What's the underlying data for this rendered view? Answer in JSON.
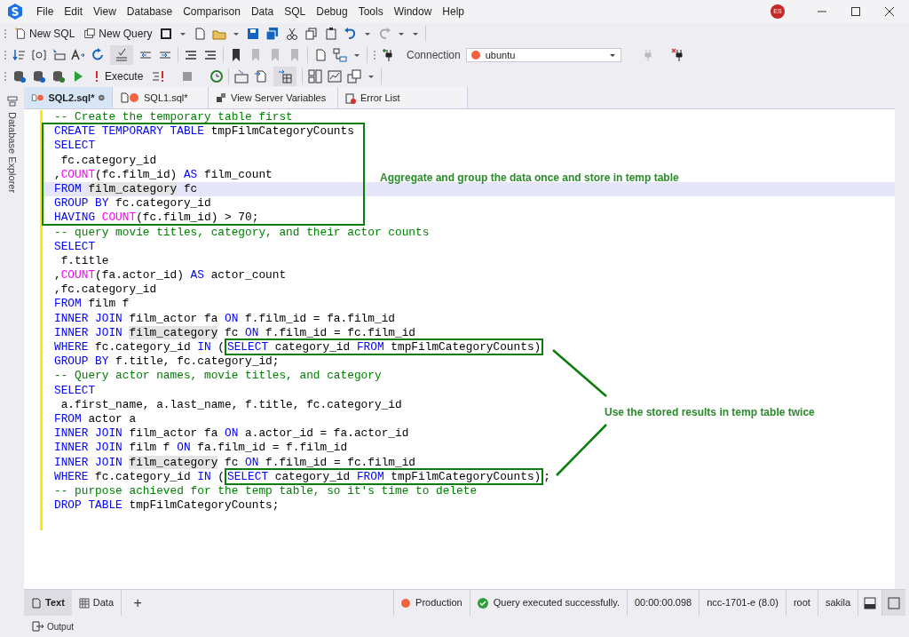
{
  "menu": [
    "File",
    "Edit",
    "View",
    "Database",
    "Comparison",
    "Data",
    "SQL",
    "Debug",
    "Tools",
    "Window",
    "Help"
  ],
  "avatar": "ES",
  "toolbar": {
    "new_sql": "New SQL",
    "new_query": "New Query",
    "execute": "Execute",
    "connection_label": "Connection",
    "connection": "ubuntu"
  },
  "tabs": [
    {
      "label": "SQL2.sql*",
      "kind": "sql",
      "selected": true
    },
    {
      "label": "SQL1.sql*",
      "kind": "sql",
      "selected": false
    },
    {
      "label": "View Server Variables",
      "kind": "variables",
      "selected": false
    },
    {
      "label": "Error List",
      "kind": "errors",
      "selected": false
    }
  ],
  "sidebar": {
    "label": "Database Explorer"
  },
  "editor": {
    "lines": [
      {
        "current": false,
        "tokens": [
          {
            "kind": "cm",
            "text": "-- Create the temporary table first"
          }
        ]
      },
      {
        "current": false,
        "tokens": [
          {
            "kind": "kw",
            "text": "CREATE TEMPORARY TABLE"
          },
          {
            "kind": "tx",
            "text": " tmpFilmCategoryCounts"
          }
        ]
      },
      {
        "current": false,
        "tokens": [
          {
            "kind": "kw",
            "text": "SELECT"
          }
        ]
      },
      {
        "current": false,
        "tokens": [
          {
            "kind": "tx",
            "text": " fc.category_id"
          }
        ]
      },
      {
        "current": false,
        "tokens": [
          {
            "kind": "tx",
            "text": ","
          },
          {
            "kind": "fn",
            "text": "COUNT"
          },
          {
            "kind": "tx",
            "text": "(fc.film_id) "
          },
          {
            "kind": "kw",
            "text": "AS"
          },
          {
            "kind": "tx",
            "text": " film_count"
          }
        ]
      },
      {
        "current": true,
        "tokens": [
          {
            "kind": "kw",
            "text": "FROM "
          },
          {
            "kind": "hl",
            "text": "film_category"
          },
          {
            "kind": "tx",
            "text": " fc"
          }
        ]
      },
      {
        "current": false,
        "tokens": [
          {
            "kind": "kw",
            "text": "GROUP BY"
          },
          {
            "kind": "tx",
            "text": " fc.category_id"
          }
        ]
      },
      {
        "current": false,
        "tokens": [
          {
            "kind": "kw",
            "text": "HAVING "
          },
          {
            "kind": "fn",
            "text": "COUNT"
          },
          {
            "kind": "tx",
            "text": "(fc.film_id) > 70;"
          }
        ]
      },
      {
        "current": false,
        "tokens": [
          {
            "kind": "cm",
            "text": "-- query movie titles, category, and their actor counts"
          }
        ]
      },
      {
        "current": false,
        "tokens": [
          {
            "kind": "kw",
            "text": "SELECT"
          }
        ]
      },
      {
        "current": false,
        "tokens": [
          {
            "kind": "tx",
            "text": " f.title"
          }
        ]
      },
      {
        "current": false,
        "tokens": [
          {
            "kind": "tx",
            "text": ","
          },
          {
            "kind": "fn",
            "text": "COUNT"
          },
          {
            "kind": "tx",
            "text": "(fa.actor_id) "
          },
          {
            "kind": "kw",
            "text": "AS"
          },
          {
            "kind": "tx",
            "text": " actor_count"
          }
        ]
      },
      {
        "current": false,
        "tokens": [
          {
            "kind": "tx",
            "text": ",fc.category_id"
          }
        ]
      },
      {
        "current": false,
        "tokens": [
          {
            "kind": "kw",
            "text": "FROM"
          },
          {
            "kind": "tx",
            "text": " film f"
          }
        ]
      },
      {
        "current": false,
        "tokens": [
          {
            "kind": "kw",
            "text": "INNER JOIN"
          },
          {
            "kind": "tx",
            "text": " film_actor fa "
          },
          {
            "kind": "kw",
            "text": "ON"
          },
          {
            "kind": "tx",
            "text": " f.film_id = fa.film_id"
          }
        ]
      },
      {
        "current": false,
        "tokens": [
          {
            "kind": "kw",
            "text": "INNER JOIN "
          },
          {
            "kind": "hl",
            "text": "film_category"
          },
          {
            "kind": "tx",
            "text": " fc "
          },
          {
            "kind": "kw",
            "text": "ON"
          },
          {
            "kind": "tx",
            "text": " f.film_id = fc.film_id"
          }
        ]
      },
      {
        "current": false,
        "tokens": [
          {
            "kind": "kw",
            "text": "WHERE"
          },
          {
            "kind": "tx",
            "text": " fc.category_id "
          },
          {
            "kind": "kw",
            "text": "IN"
          },
          {
            "kind": "tx",
            "text": " ("
          }
        ],
        "framed_tokens": [
          {
            "kind": "kw",
            "text": "SELECT"
          },
          {
            "kind": "tx",
            "text": " category_id "
          },
          {
            "kind": "kw",
            "text": "FROM"
          },
          {
            "kind": "tx",
            "text": " tmpFilmCategoryCounts)"
          }
        ]
      },
      {
        "current": false,
        "tokens": [
          {
            "kind": "kw",
            "text": "GROUP BY"
          },
          {
            "kind": "tx",
            "text": " f.title, fc.category_id;"
          }
        ]
      },
      {
        "current": false,
        "tokens": [
          {
            "kind": "cm",
            "text": "-- Query actor names, movie titles, and category"
          }
        ]
      },
      {
        "current": false,
        "tokens": [
          {
            "kind": "kw",
            "text": "SELECT"
          }
        ]
      },
      {
        "current": false,
        "tokens": [
          {
            "kind": "tx",
            "text": " a.first_name, a.last_name, f.title, fc.category_id"
          }
        ]
      },
      {
        "current": false,
        "tokens": [
          {
            "kind": "kw",
            "text": "FROM"
          },
          {
            "kind": "tx",
            "text": " actor a"
          }
        ]
      },
      {
        "current": false,
        "tokens": [
          {
            "kind": "kw",
            "text": "INNER JOIN"
          },
          {
            "kind": "tx",
            "text": " film_actor fa "
          },
          {
            "kind": "kw",
            "text": "ON"
          },
          {
            "kind": "tx",
            "text": " a.actor_id = fa.actor_id"
          }
        ]
      },
      {
        "current": false,
        "tokens": [
          {
            "kind": "kw",
            "text": "INNER JOIN"
          },
          {
            "kind": "tx",
            "text": " film f "
          },
          {
            "kind": "kw",
            "text": "ON"
          },
          {
            "kind": "tx",
            "text": " fa.film_id = f.film_id"
          }
        ]
      },
      {
        "current": false,
        "tokens": [
          {
            "kind": "kw",
            "text": "INNER JOIN "
          },
          {
            "kind": "hl",
            "text": "film_category"
          },
          {
            "kind": "tx",
            "text": " fc "
          },
          {
            "kind": "kw",
            "text": "ON"
          },
          {
            "kind": "tx",
            "text": " f.film_id = fc.film_id"
          }
        ]
      },
      {
        "current": false,
        "tokens": [
          {
            "kind": "kw",
            "text": "WHERE"
          },
          {
            "kind": "tx",
            "text": " fc.category_id "
          },
          {
            "kind": "kw",
            "text": "IN"
          },
          {
            "kind": "tx",
            "text": " ("
          }
        ],
        "framed_tokens": [
          {
            "kind": "kw",
            "text": "SELECT"
          },
          {
            "kind": "tx",
            "text": " category_id "
          },
          {
            "kind": "kw",
            "text": "FROM"
          },
          {
            "kind": "tx",
            "text": " tmpFilmCategoryCounts)"
          }
        ],
        "tail_tokens": [
          {
            "kind": "tx",
            "text": ";"
          }
        ]
      },
      {
        "current": false,
        "tokens": [
          {
            "kind": "cm",
            "text": "-- purpose achieved for the temp table, so it's time to delete"
          }
        ]
      },
      {
        "current": false,
        "tokens": [
          {
            "kind": "kw",
            "text": "DROP TABLE"
          },
          {
            "kind": "tx",
            "text": " tmpFilmCategoryCounts;"
          }
        ]
      }
    ]
  },
  "annotations": [
    {
      "text": "Aggregate and group the data once and store in temp table"
    },
    {
      "text": "Use the stored results in temp table twice"
    }
  ],
  "bottom_tabs": [
    {
      "label": "Text",
      "selected": true
    },
    {
      "label": "Data",
      "selected": false
    }
  ],
  "add_tab": "+",
  "status_bar": {
    "environment": "Production",
    "message": "Query executed successfully.",
    "duration": "00:00:00.098",
    "server": "ncc-1701-e (8.0)",
    "user": "root",
    "database": "sakila"
  },
  "output_tab": "Output"
}
